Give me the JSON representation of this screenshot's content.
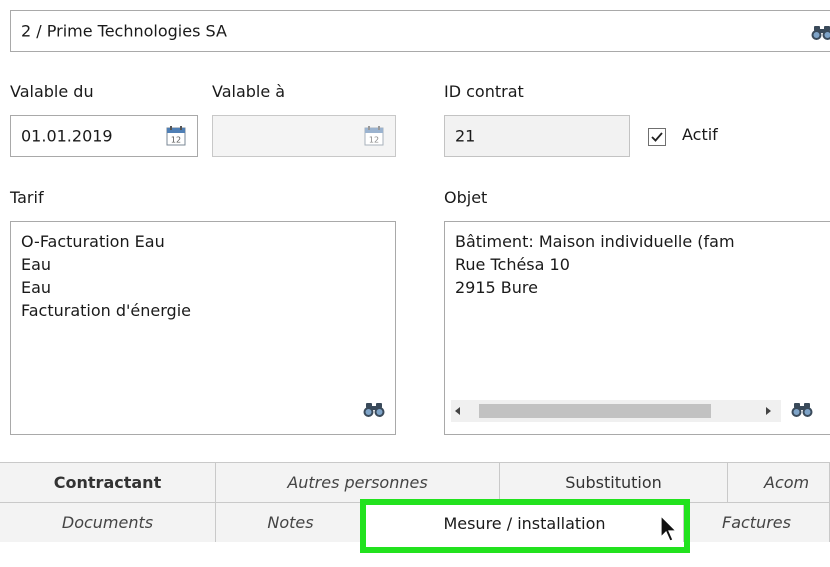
{
  "partner": {
    "value": "2 / Prime Technologies SA",
    "icon": "binoculars-icon"
  },
  "valid_from": {
    "label": "Valable du",
    "value": "01.01.2019",
    "icon": "calendar-icon"
  },
  "valid_to": {
    "label": "Valable à",
    "value": "",
    "icon": "calendar-icon"
  },
  "contract_id": {
    "label": "ID contrat",
    "value": "21"
  },
  "active": {
    "label": "Actif",
    "checked": true
  },
  "tariff": {
    "label": "Tarif",
    "lines": [
      "O-Facturation Eau",
      "Eau",
      "Eau",
      "Facturation d'énergie"
    ],
    "icon": "binoculars-icon"
  },
  "object": {
    "label": "Objet",
    "lines": [
      "Bâtiment: Maison individuelle (fam",
      "Rue Tchésa 10",
      "2915 Bure"
    ],
    "icon": "binoculars-icon"
  },
  "tabs_row1": [
    "Contractant",
    "Autres personnes",
    "Substitution",
    "Acom"
  ],
  "tabs_row2": [
    "Documents",
    "Notes",
    "Mesure / installation",
    "Factures"
  ],
  "colors": {
    "highlight": "#22e21e",
    "tab_bg": "#f3f3f3",
    "border": "#a9a9a9"
  }
}
